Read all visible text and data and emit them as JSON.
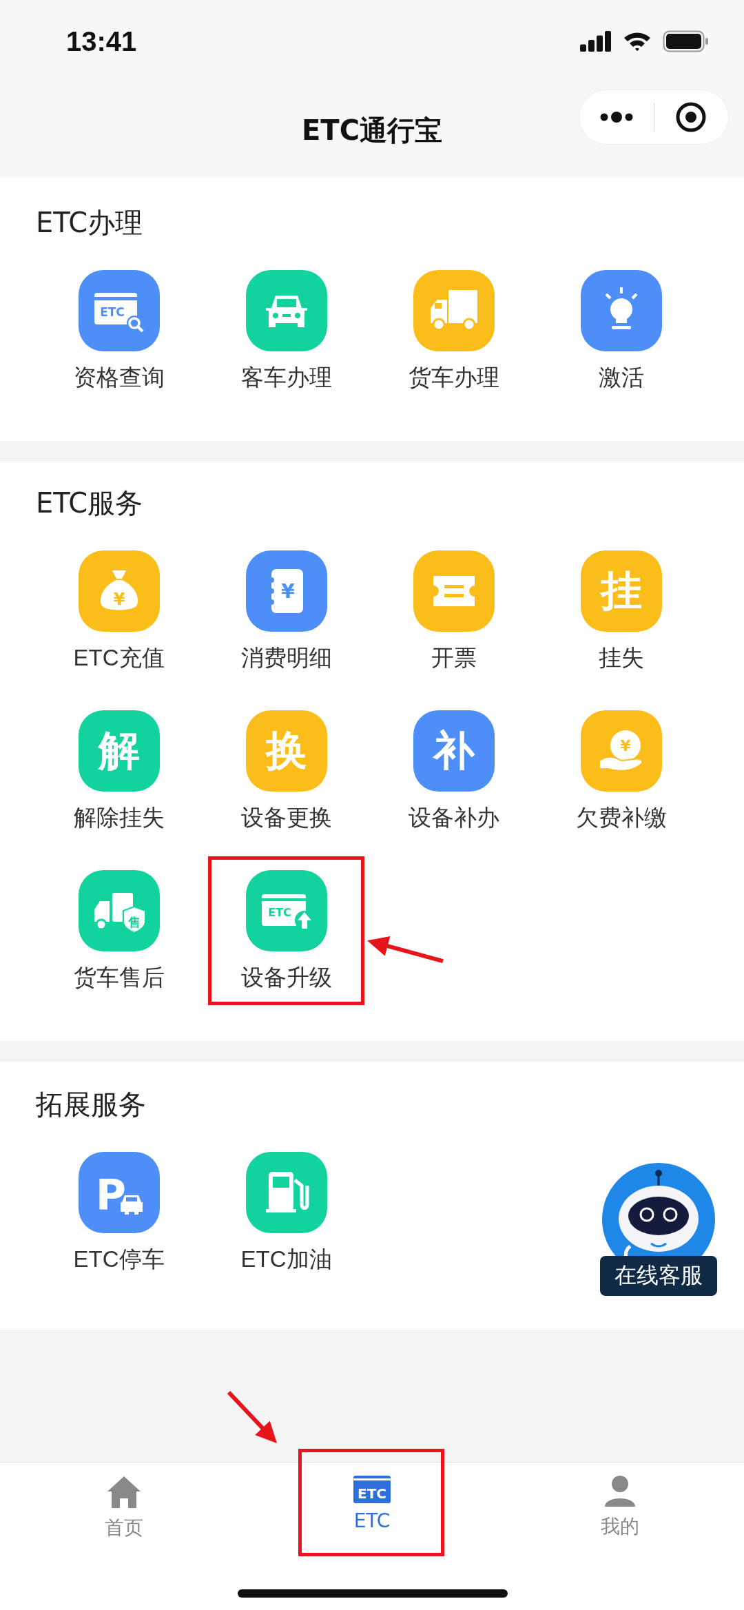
{
  "status_bar": {
    "time": "13:41"
  },
  "nav_bar": {
    "title": "ETC通行宝"
  },
  "sections": [
    {
      "title": "ETC办理",
      "items": [
        {
          "label": "资格查询",
          "color": "#4d8ef8",
          "glyph": "ETC",
          "highlighted": false
        },
        {
          "label": "客车办理",
          "color": "#12d39d",
          "highlighted": false
        },
        {
          "label": "货车办理",
          "color": "#fbbd1a",
          "highlighted": false
        },
        {
          "label": "激活",
          "color": "#4d8ef8",
          "highlighted": false
        }
      ]
    },
    {
      "title": "ETC服务",
      "items": [
        {
          "label": "ETC充值",
          "color": "#fbbd1a",
          "glyph": "¥",
          "highlighted": false
        },
        {
          "label": "消费明细",
          "color": "#4d8ef8",
          "glyph": "¥",
          "highlighted": false
        },
        {
          "label": "开票",
          "color": "#fbbd1a",
          "highlighted": false
        },
        {
          "label": "挂失",
          "color": "#fbbd1a",
          "glyph": "挂",
          "highlighted": false
        },
        {
          "label": "解除挂失",
          "color": "#12d39d",
          "glyph": "解",
          "highlighted": false
        },
        {
          "label": "设备更换",
          "color": "#fbbd1a",
          "glyph": "换",
          "highlighted": false
        },
        {
          "label": "设备补办",
          "color": "#4d8ef8",
          "glyph": "补",
          "highlighted": false
        },
        {
          "label": "欠费补缴",
          "color": "#fbbd1a",
          "glyph": "¥",
          "highlighted": false
        },
        {
          "label": "货车售后",
          "color": "#12d39d",
          "glyph": "售",
          "highlighted": false
        },
        {
          "label": "设备升级",
          "color": "#12d39d",
          "glyph": "ETC",
          "highlighted": true
        }
      ]
    },
    {
      "title": "拓展服务",
      "items": [
        {
          "label": "ETC停车",
          "color": "#4d8ef8",
          "glyph": "P",
          "highlighted": false
        },
        {
          "label": "ETC加油",
          "color": "#12d39d",
          "highlighted": false
        }
      ]
    }
  ],
  "customer_service": {
    "label": "在线客服"
  },
  "tab_bar": [
    {
      "label": "首页",
      "selected": false,
      "highlighted": false
    },
    {
      "label": "ETC",
      "glyph": "ETC",
      "selected": true,
      "highlighted": true
    },
    {
      "label": "我的",
      "selected": false,
      "highlighted": false
    }
  ]
}
